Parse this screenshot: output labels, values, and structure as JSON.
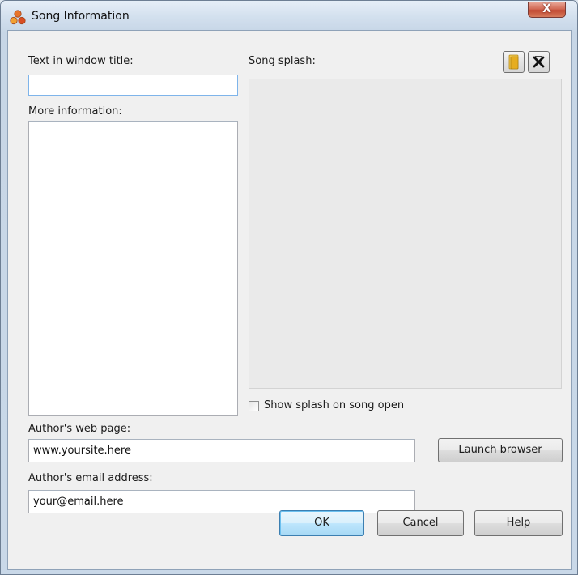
{
  "window": {
    "title": "Song Information",
    "close_label": "X"
  },
  "fields": {
    "window_title_label": "Text in window title:",
    "window_title_value": "",
    "more_info_label": "More information:",
    "more_info_value": "",
    "song_splash_label": "Song splash:",
    "show_splash_label": "Show splash on song open",
    "show_splash_checked": false,
    "web_page_label": "Author's web page:",
    "web_page_value": "www.yoursite.here",
    "email_label": "Author's email address:",
    "email_value": "your@email.here"
  },
  "buttons": {
    "launch_browser": "Launch browser",
    "ok": "OK",
    "cancel": "Cancel",
    "help": "Help"
  },
  "icons": {
    "app": "app-logo-icon",
    "open_folder": "folder-icon",
    "remove": "remove-x-icon"
  },
  "colors": {
    "default_button_border": "#3c7fb1",
    "close_button": "#c24a33"
  }
}
